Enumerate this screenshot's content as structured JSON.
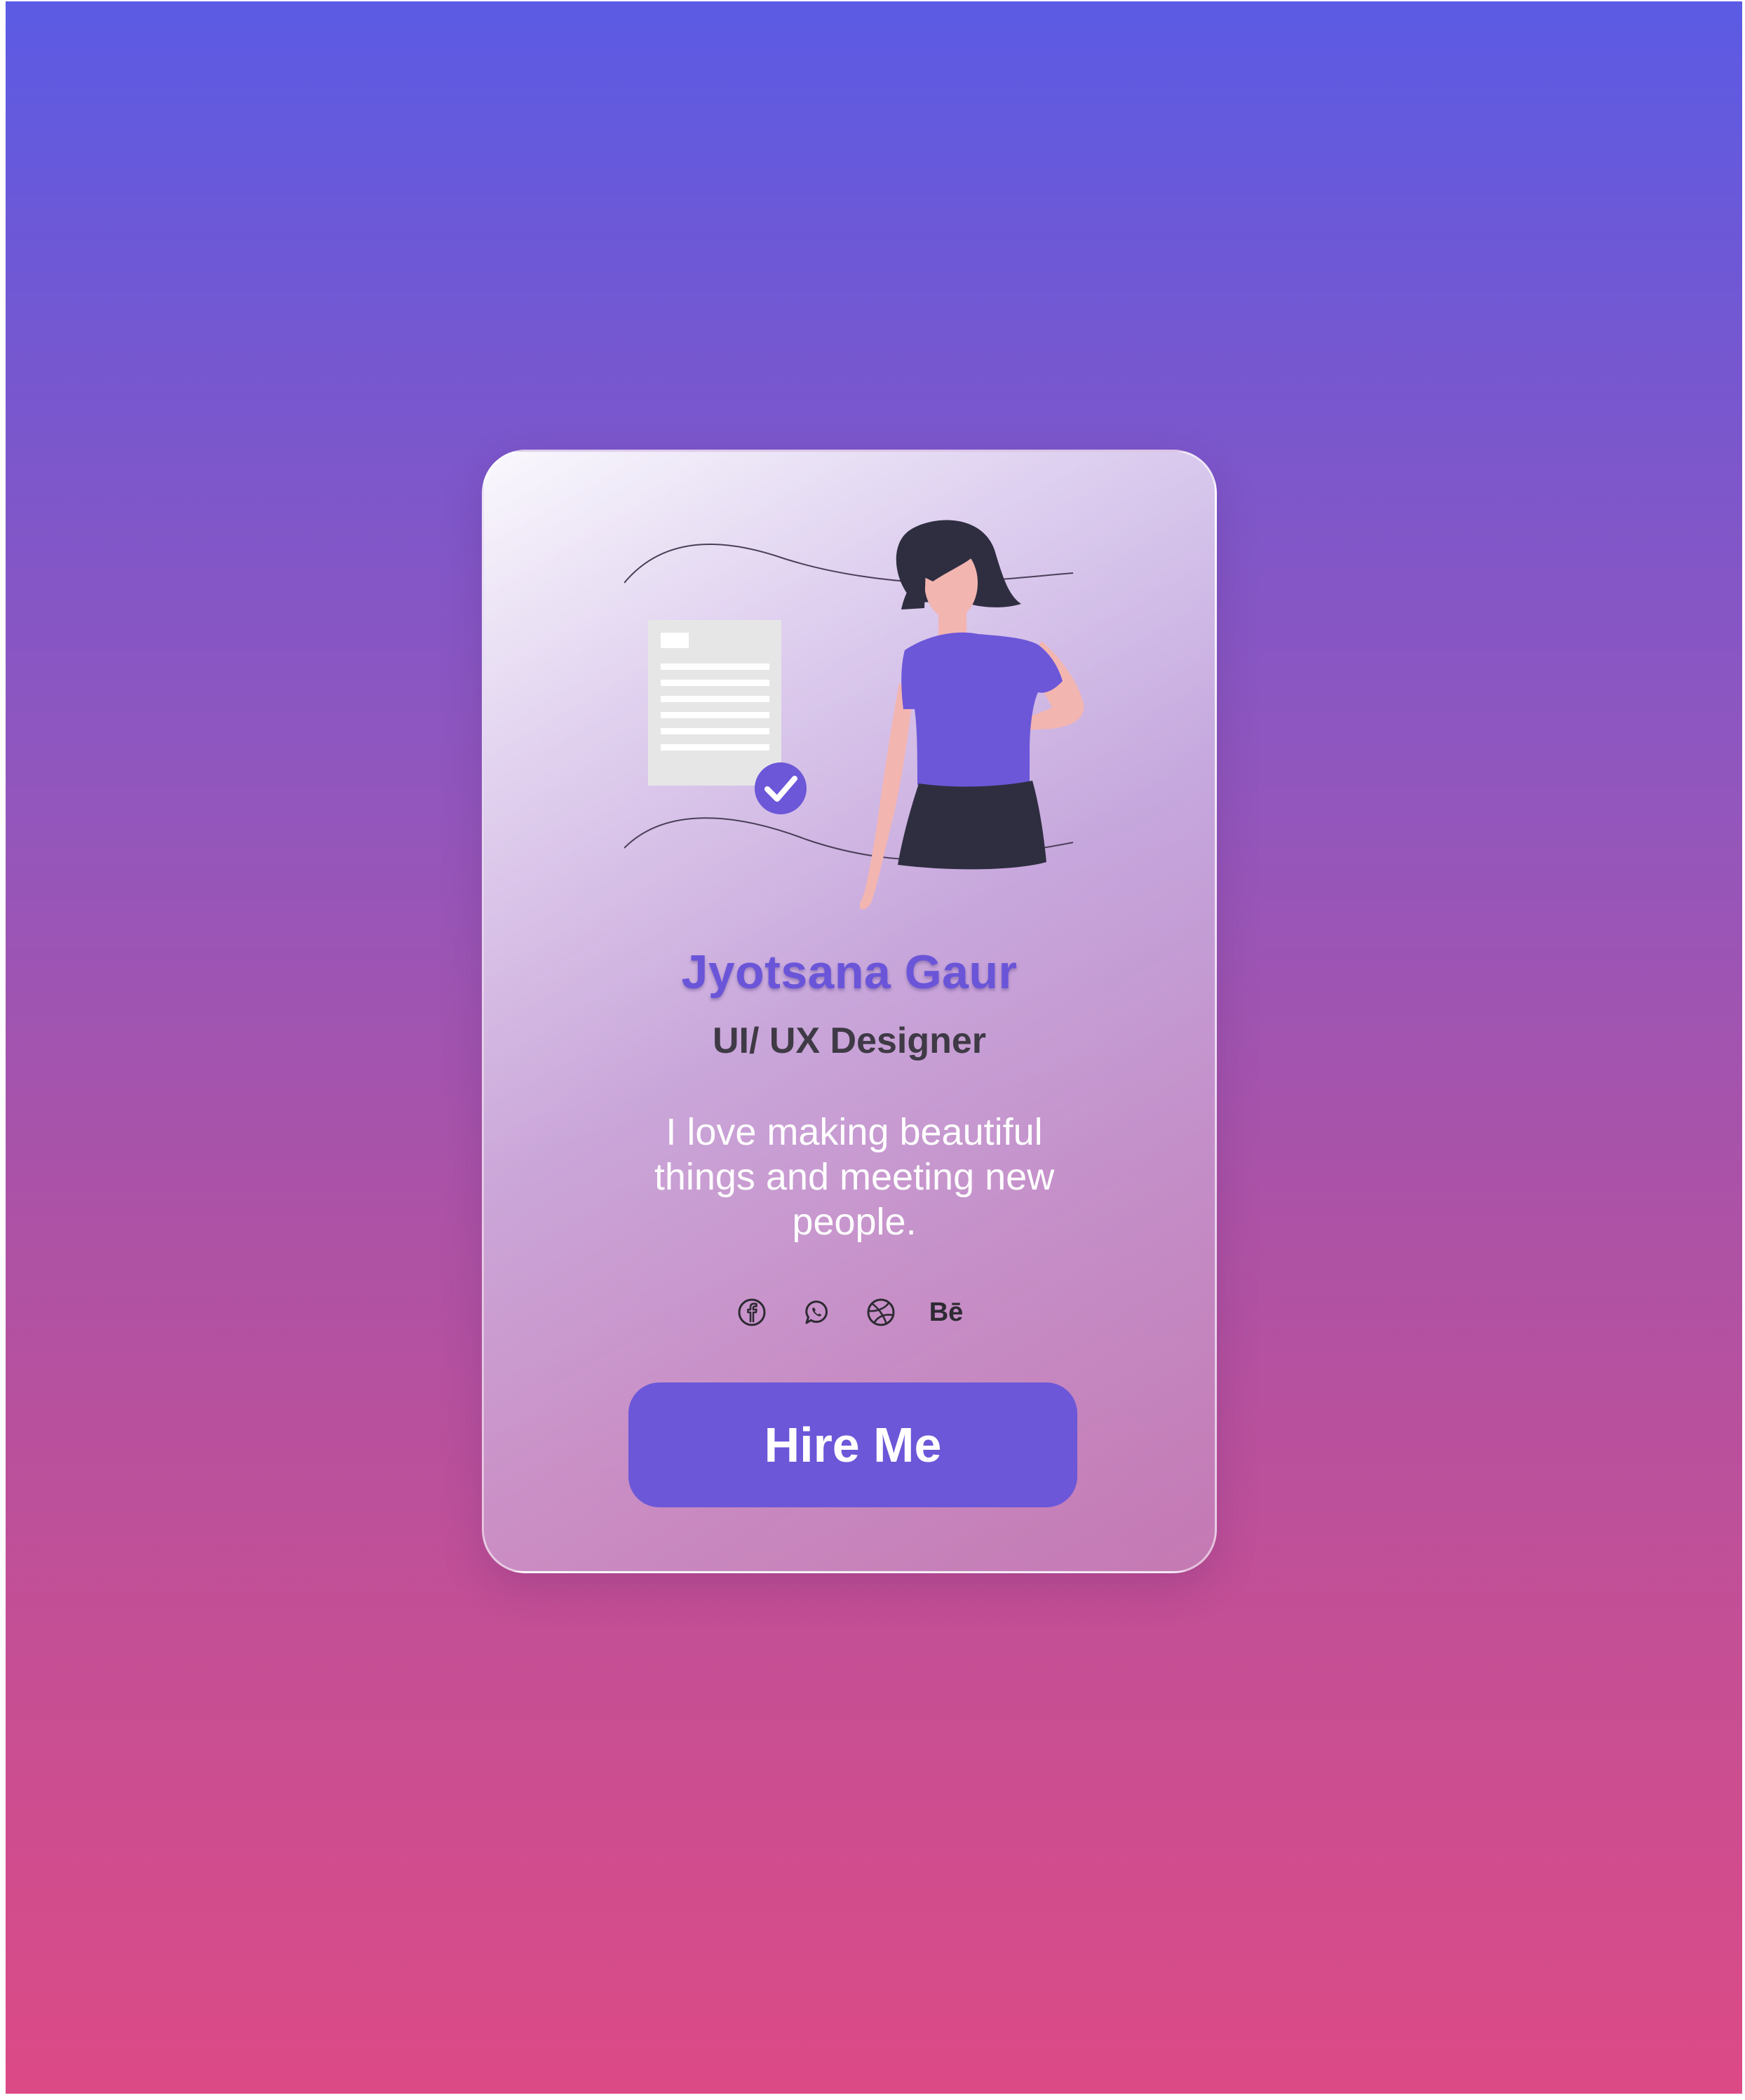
{
  "profile": {
    "name": "Jyotsana Gaur",
    "role": "UI/ UX Designer",
    "bio": "I love making beautiful things and meeting new people."
  },
  "socials": [
    {
      "icon": "facebook-icon"
    },
    {
      "icon": "whatsapp-icon"
    },
    {
      "icon": "dribbble-icon"
    },
    {
      "icon": "behance-icon",
      "label": "Bē"
    }
  ],
  "cta": {
    "label": "Hire Me"
  },
  "colors": {
    "accent": "#6b57d8",
    "name": "#6a55d9",
    "role": "#3f3a45",
    "gradient_top": "#5b5be4",
    "gradient_bottom": "#dc4a86"
  }
}
